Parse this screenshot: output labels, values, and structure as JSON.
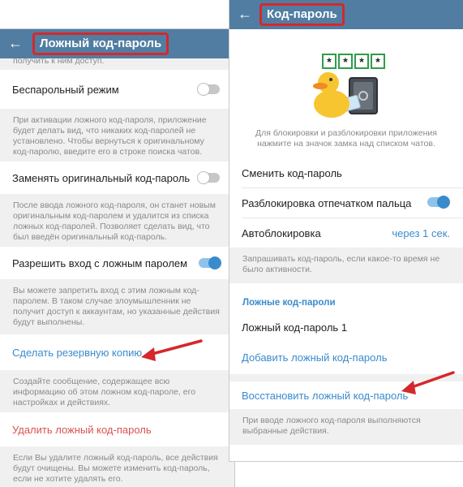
{
  "left": {
    "title": "Ложный код-пароль",
    "partial_text": "получить к ним доступ.",
    "passwordless": {
      "label": "Беспарольный режим",
      "enabled": false
    },
    "passwordless_note": "При активации ложного код-пароля, приложение будет делать вид, что никаких код-паролей не установлено. Чтобы вернуться к оригинальному код-паролю, введите его в строке поиска чатов.",
    "replace": {
      "label": "Заменять оригинальный код-пароль",
      "enabled": false
    },
    "replace_note": "После ввода ложного код-пароля, он станет новым оригинальным код-паролем и удалится из списка ложных код-паролей. Позволяет сделать вид, что был введён оригинальный код-пароль.",
    "allow_login": {
      "label": "Разрешить вход с ложным паролем",
      "enabled": true
    },
    "allow_login_note": "Вы можете запретить вход с этим ложным код-паролем. В таком случае злоумышленник не получит доступ к аккаунтам, но указанные действия будут выполнены.",
    "backup_label": "Сделать резервную копию",
    "backup_note": "Создайте сообщение, содержащее всю информацию об этом ложном код-пароле, его настройках и действиях.",
    "delete_label": "Удалить ложный код-пароль",
    "delete_note": "Если Вы удалите ложный код-пароль, все действия будут очищены. Вы можете изменить код-пароль, если не хотите удалять его."
  },
  "right": {
    "title": "Код-пароль",
    "pin_chars": [
      "*",
      "*",
      "*",
      "*"
    ],
    "intro_note": "Для блокировки и разблокировки приложения нажмите на значок замка над списком чатов.",
    "change_label": "Сменить код-пароль",
    "fingerprint": {
      "label": "Разблокировка отпечатком пальца",
      "enabled": true
    },
    "autolock_label": "Автоблокировка",
    "autolock_value": "через 1 сек.",
    "autolock_note": "Запрашивать код-пароль, если какое-то время не было активности.",
    "fake_section": "Ложные код-пароли",
    "fake_item": "Ложный код-пароль 1",
    "add_label": "Добавить ложный код-пароль",
    "restore_label": "Восстановить ложный код-пароль",
    "restore_note": "При вводе ложного код-пароля выполняются выбранные действия."
  },
  "colors": {
    "header": "#517da2",
    "accent": "#3a8bcc",
    "annotation": "#d4282c",
    "destructive": "#d9534f"
  }
}
